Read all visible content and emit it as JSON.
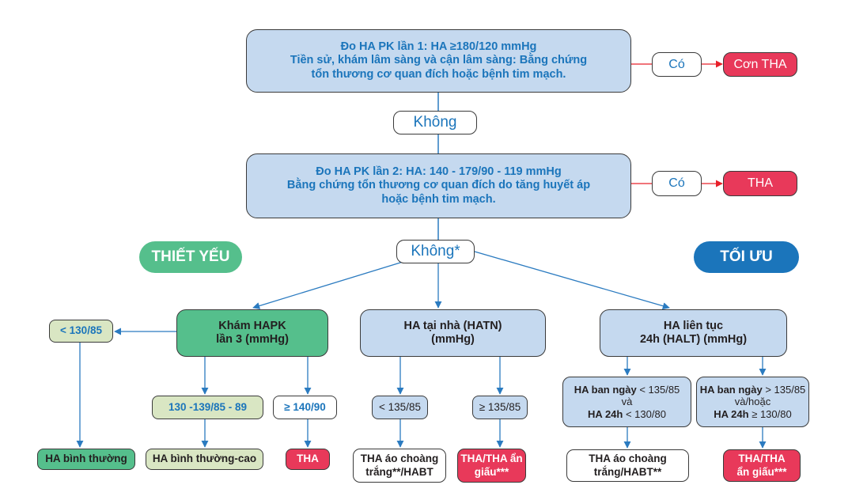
{
  "colors": {
    "blue_text": "#1b75bb",
    "light_blue_fill": "#c5d9ef",
    "green_fill": "#55bf8c",
    "pale_green_fill": "#d9e6c3",
    "red_fill": "#e8395a",
    "connector_blue": "#2b7bc0",
    "connector_red": "#e8202a",
    "optimal_pill": "#1b75bb"
  },
  "step1": {
    "line1": "Đo HA PK lần 1: HA ≥180/120 mmHg",
    "line2": "Tiền sử, khám lâm sàng và cận lâm sàng: Bằng chứng",
    "line3": "tổn thương cơ quan đích hoặc bệnh tim mạch.",
    "yes_label": "Có",
    "yes_result": "Cơn THA",
    "no_label": "Không"
  },
  "step2": {
    "line1": "Đo HA PK lần 2: HA: 140 - 179/90 - 119 mmHg",
    "line2": "Bằng chứng tổn thương cơ quan đích do tăng huyết áp",
    "line3": "hoặc bệnh tim mạch.",
    "yes_label": "Có",
    "yes_result": "THA",
    "no_label": "Không*"
  },
  "tiers": {
    "essential": "THIẾT YẾU",
    "optimal": "TỐI ƯU"
  },
  "branch_office": {
    "title_line1": "Khám HAPK",
    "title_line2": "lần 3 (mmHg)",
    "low": {
      "label": "< 130/85",
      "result": "HA bình thường"
    },
    "mid": {
      "label": "130 -139/85 - 89",
      "result": "HA bình thường-cao"
    },
    "high": {
      "label": "≥ 140/90",
      "result": "THA"
    }
  },
  "branch_home": {
    "title_line1": "HA tại nhà (HATN)",
    "title_line2": "(mmHg)",
    "low": {
      "label": "< 135/85",
      "result_line1": "THA áo choàng",
      "result_line2": "trắng**/HABT"
    },
    "high": {
      "label": "≥ 135/85",
      "result_line1": "THA/THA ẩn",
      "result_line2": "giấu***"
    }
  },
  "branch_ambulatory": {
    "title_line1": "HA liên tục",
    "title_line2": "24h (HALT) (mmHg)",
    "low": {
      "day_label": "HA ban ngày",
      "day_value": " < 135/85",
      "joiner": "và",
      "h24_label": "HA 24h",
      "h24_value": " < 130/80",
      "result_line1": "THA áo choàng",
      "result_line2": "trắng/HABT**"
    },
    "high": {
      "day_label": "HA ban ngày",
      "day_value": " > 135/85",
      "joiner": "và/hoặc",
      "h24_label": "HA 24h",
      "h24_value": " ≥ 130/80",
      "result_line1": "THA/THA",
      "result_line2": "ẩn giấu***"
    }
  }
}
